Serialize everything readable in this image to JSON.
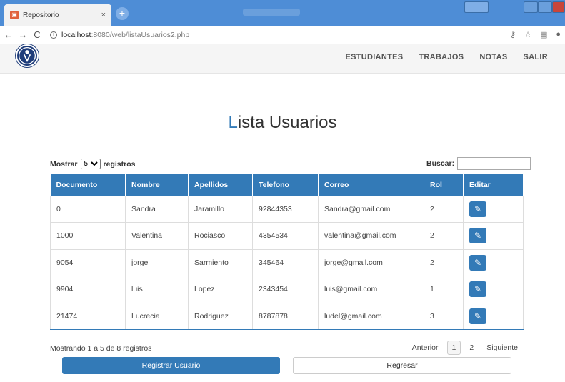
{
  "browser": {
    "tab_title": "Repositorio",
    "tab_close": "×",
    "new_tab": "+",
    "url_host": "localhost",
    "url_path": ":8080/web/listaUsuarios2.php",
    "back": "←",
    "forward": "→",
    "reload": "C",
    "info": "i"
  },
  "nav": {
    "links": [
      "ESTUDIANTES",
      "TRABAJOS",
      "NOTAS",
      "SALIR"
    ]
  },
  "page": {
    "title_first": "L",
    "title_rest": "ista Usuarios"
  },
  "controls": {
    "length_prefix": "Mostrar",
    "length_value": "5",
    "length_suffix": "registros",
    "search_label": "Buscar:"
  },
  "table": {
    "headers": [
      "Documento",
      "Nombre",
      "Apellidos",
      "Telefono",
      "Correo",
      "Rol",
      "Editar"
    ],
    "rows": [
      [
        "0",
        "Sandra",
        "Jaramillo",
        "92844353",
        "Sandra@gmail.com",
        "2"
      ],
      [
        "1000",
        "Valentina",
        "Rociasco",
        "4354534",
        "valentina@gmail.com",
        "2"
      ],
      [
        "9054",
        "jorge",
        "Sarmiento",
        "345464",
        "jorge@gmail.com",
        "2"
      ],
      [
        "9904",
        "luis",
        "Lopez",
        "2343454",
        "luis@gmail.com",
        "1"
      ],
      [
        "21474",
        "Lucrecia",
        "Rodriguez",
        "8787878",
        "ludel@gmail.com",
        "3"
      ]
    ]
  },
  "footer": {
    "info": "Mostrando 1 a 5 de 8 registros",
    "prev": "Anterior",
    "pages": [
      "1",
      "2"
    ],
    "next": "Siguiente",
    "register_button": "Registrar Usuario",
    "back_button": "Regresar"
  },
  "colors": {
    "primary": "#337ab7",
    "tabbar": "#4e8dd6"
  },
  "icons": {
    "edit": "pencil-icon",
    "logo": "university-logo"
  }
}
